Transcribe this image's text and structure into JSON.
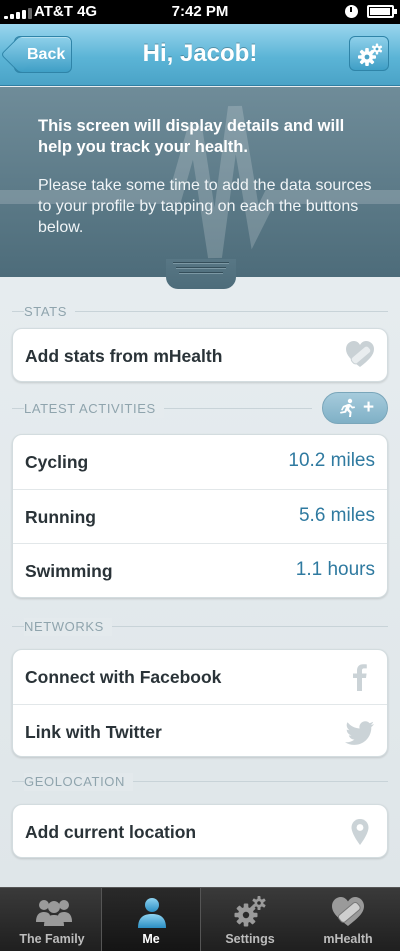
{
  "status_bar": {
    "carrier": "AT&T",
    "network": "4G",
    "time": "7:42 PM"
  },
  "nav": {
    "back_label": "Back",
    "title": "Hi, Jacob!"
  },
  "intro": {
    "headline": "This screen will display details and will help you track your health.",
    "body": "Please take some time to add the data sources to your profile by tapping on each the buttons below."
  },
  "sections": {
    "stats": "STATS",
    "latest_activities": "LATEST ACTIVITIES",
    "networks": "NETWORKS",
    "geolocation": "GEOLOCATION"
  },
  "stats": {
    "add_label": "Add stats from mHealth"
  },
  "activities": [
    {
      "name": "Cycling",
      "value": "10.2 miles"
    },
    {
      "name": "Running",
      "value": "5.6 miles"
    },
    {
      "name": "Swimming",
      "value": "1.1 hours"
    }
  ],
  "activity_add": {
    "plus": "+"
  },
  "networks": {
    "facebook": "Connect with Facebook",
    "twitter": "Link with Twitter"
  },
  "geolocation": {
    "add_label": "Add current location"
  },
  "tabs": [
    {
      "label": "The Family",
      "icon": "family-icon"
    },
    {
      "label": "Me",
      "icon": "person-icon"
    },
    {
      "label": "Settings",
      "icon": "gears-icon"
    },
    {
      "label": "mHealth",
      "icon": "heart-bandage-icon"
    }
  ],
  "colors": {
    "accent": "#2f7aa0",
    "nav": "#5bb4d6",
    "banner": "#5e7d8a"
  }
}
